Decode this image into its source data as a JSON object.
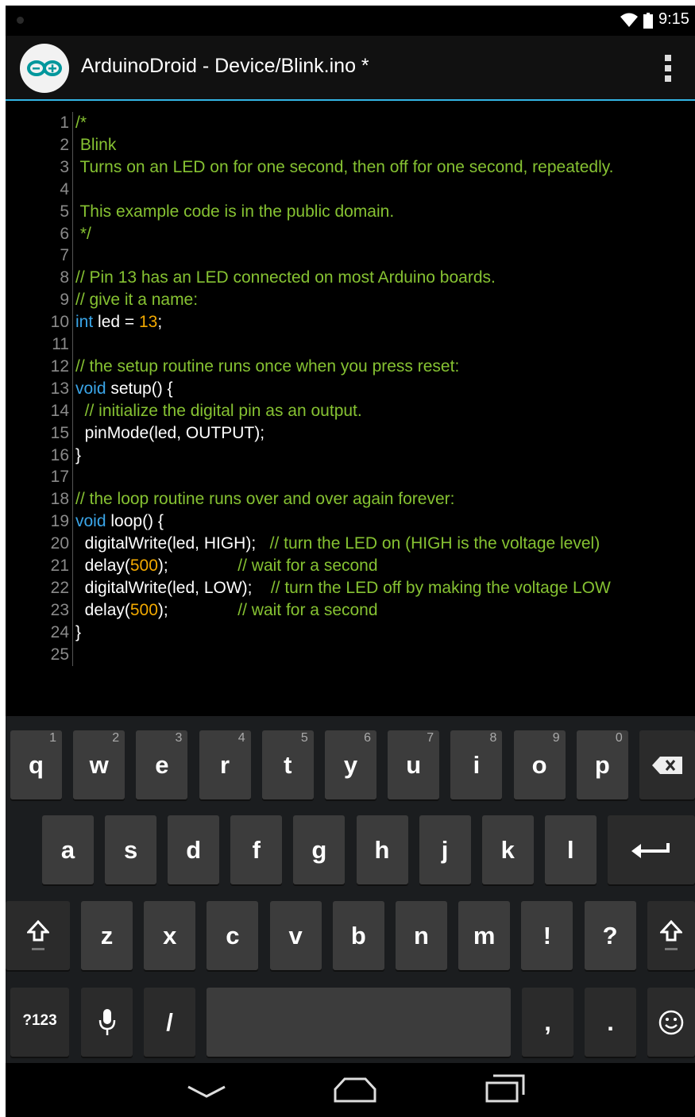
{
  "status_bar": {
    "time": "9:15"
  },
  "action_bar": {
    "title": "ArduinoDroid - Device/Blink.ino *"
  },
  "editor": {
    "lines": [
      {
        "n": "1",
        "parts": [
          {
            "t": "/*",
            "c": "comment"
          }
        ]
      },
      {
        "n": "2",
        "parts": [
          {
            "t": " Blink",
            "c": "comment"
          }
        ]
      },
      {
        "n": "3",
        "parts": [
          {
            "t": " Turns on an LED on for one second, then off for one second, repeatedly.",
            "c": "comment"
          }
        ]
      },
      {
        "n": "4",
        "parts": []
      },
      {
        "n": "5",
        "parts": [
          {
            "t": " This example code is in the public domain.",
            "c": "comment"
          }
        ]
      },
      {
        "n": "6",
        "parts": [
          {
            "t": " */",
            "c": "comment"
          }
        ]
      },
      {
        "n": "7",
        "parts": []
      },
      {
        "n": "8",
        "parts": [
          {
            "t": "// Pin 13 has an LED connected on most Arduino boards.",
            "c": "comment"
          }
        ]
      },
      {
        "n": "9",
        "parts": [
          {
            "t": "// give it a name:",
            "c": "comment"
          }
        ]
      },
      {
        "n": "10",
        "parts": [
          {
            "t": "int",
            "c": "keyword"
          },
          {
            "t": " led = ",
            "c": "plain"
          },
          {
            "t": "13",
            "c": "number"
          },
          {
            "t": ";",
            "c": "plain"
          }
        ]
      },
      {
        "n": "11",
        "parts": []
      },
      {
        "n": "12",
        "parts": [
          {
            "t": "// the setup routine runs once when you press reset:",
            "c": "comment"
          }
        ]
      },
      {
        "n": "13",
        "parts": [
          {
            "t": "void",
            "c": "keyword"
          },
          {
            "t": " setup() {",
            "c": "plain"
          }
        ]
      },
      {
        "n": "14",
        "parts": [
          {
            "t": "  // initialize the digital pin as an output.",
            "c": "comment"
          }
        ]
      },
      {
        "n": "15",
        "parts": [
          {
            "t": "  pinMode(led, OUTPUT);",
            "c": "plain"
          }
        ]
      },
      {
        "n": "16",
        "parts": [
          {
            "t": "}",
            "c": "plain"
          }
        ]
      },
      {
        "n": "17",
        "parts": []
      },
      {
        "n": "18",
        "parts": [
          {
            "t": "// the loop routine runs over and over again forever:",
            "c": "comment"
          }
        ]
      },
      {
        "n": "19",
        "parts": [
          {
            "t": "void",
            "c": "keyword"
          },
          {
            "t": " loop() {",
            "c": "plain"
          }
        ]
      },
      {
        "n": "20",
        "parts": [
          {
            "t": "  digitalWrite(led, HIGH);   ",
            "c": "plain"
          },
          {
            "t": "// turn the LED on (HIGH is the voltage level)",
            "c": "comment"
          }
        ]
      },
      {
        "n": "21",
        "parts": [
          {
            "t": "  delay(",
            "c": "plain"
          },
          {
            "t": "500",
            "c": "number"
          },
          {
            "t": ");               ",
            "c": "plain"
          },
          {
            "t": "// wait for a second",
            "c": "comment"
          }
        ]
      },
      {
        "n": "22",
        "parts": [
          {
            "t": "  digitalWrite(led, LOW);    ",
            "c": "plain"
          },
          {
            "t": "// turn the LED off by making the voltage LOW",
            "c": "comment"
          }
        ]
      },
      {
        "n": "23",
        "parts": [
          {
            "t": "  delay(",
            "c": "plain"
          },
          {
            "t": "500",
            "c": "number"
          },
          {
            "t": ");               ",
            "c": "plain"
          },
          {
            "t": "// wait for a second",
            "c": "comment"
          }
        ]
      },
      {
        "n": "24",
        "parts": [
          {
            "t": "}",
            "c": "plain"
          }
        ]
      },
      {
        "n": "25",
        "parts": []
      }
    ]
  },
  "keyboard": {
    "row1": [
      {
        "label": "q",
        "hint": "1"
      },
      {
        "label": "w",
        "hint": "2"
      },
      {
        "label": "e",
        "hint": "3"
      },
      {
        "label": "r",
        "hint": "4"
      },
      {
        "label": "t",
        "hint": "5"
      },
      {
        "label": "y",
        "hint": "6"
      },
      {
        "label": "u",
        "hint": "7"
      },
      {
        "label": "i",
        "hint": "8"
      },
      {
        "label": "o",
        "hint": "9"
      },
      {
        "label": "p",
        "hint": "0"
      }
    ],
    "row2": [
      {
        "label": "a"
      },
      {
        "label": "s"
      },
      {
        "label": "d"
      },
      {
        "label": "f"
      },
      {
        "label": "g"
      },
      {
        "label": "h"
      },
      {
        "label": "j"
      },
      {
        "label": "k"
      },
      {
        "label": "l"
      }
    ],
    "row3": [
      {
        "label": "z"
      },
      {
        "label": "x"
      },
      {
        "label": "c"
      },
      {
        "label": "v"
      },
      {
        "label": "b"
      },
      {
        "label": "n"
      },
      {
        "label": "m"
      },
      {
        "label": "!"
      },
      {
        "label": "?"
      }
    ],
    "symbols_label": "?123",
    "slash_label": "/",
    "comma_label": ",",
    "period_label": ".",
    "icons": {
      "backspace": "backspace-icon",
      "enter": "enter-icon",
      "shift": "shift-icon",
      "mic": "microphone-icon",
      "emoji": "emoji-icon"
    }
  },
  "colors": {
    "accent": "#33b5e5",
    "comment": "#86c232",
    "keyword": "#3aa5e8",
    "number": "#f2a900"
  }
}
